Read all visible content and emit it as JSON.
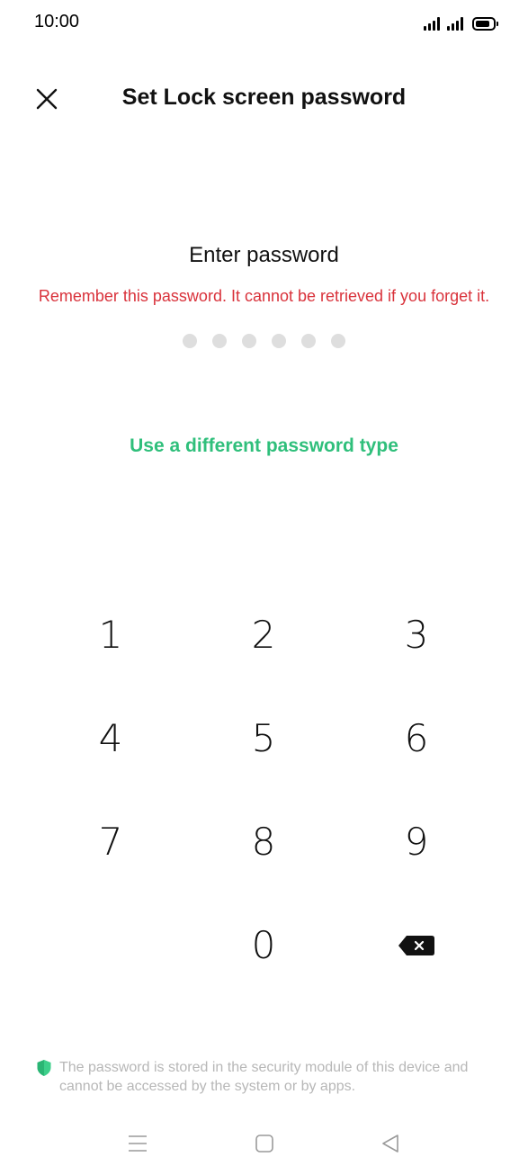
{
  "status_bar": {
    "time": "10:00",
    "battery_level_fraction": 0.85
  },
  "header": {
    "close_icon": "close-icon",
    "title": "Set Lock screen password"
  },
  "main": {
    "prompt": "Enter password",
    "warning": "Remember this password. It cannot be retrieved if you forget it.",
    "pin_length": 6,
    "pin_entered": 0,
    "alt_type_link": "Use a different password type"
  },
  "keypad": {
    "keys": [
      "1",
      "2",
      "3",
      "4",
      "5",
      "6",
      "7",
      "8",
      "9",
      "",
      "0",
      "backspace"
    ],
    "backspace_icon": "backspace-icon"
  },
  "footer": {
    "shield_icon": "shield-icon",
    "note": "The password is stored in the security module of this device and cannot be accessed by the system or by apps."
  },
  "nav_bar": {
    "menu_icon": "menu-icon",
    "home_icon": "home-icon",
    "back_icon": "back-icon"
  },
  "colors": {
    "warning": "#d9323b",
    "accent": "#2fbf7b",
    "dot_empty": "#dedede",
    "footer_text": "#b7b7b7",
    "shield": "#3ccf8a"
  }
}
